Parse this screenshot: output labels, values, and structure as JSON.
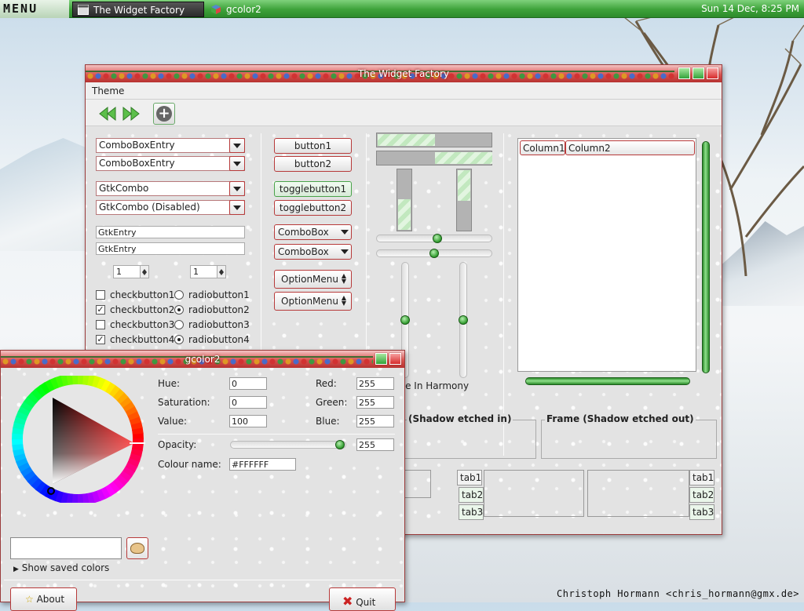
{
  "panel": {
    "menu_label": "MENU",
    "tasks": [
      {
        "label": "The Widget Factory"
      },
      {
        "label": "gcolor2"
      }
    ],
    "clock": "Sun 14 Dec,  8:25 PM"
  },
  "desktop": {
    "credit": "Christoph Hormann <chris_hormann@gmx.de>"
  },
  "widget_factory": {
    "title": "The Widget Factory",
    "menu": [
      "Theme"
    ],
    "combos": [
      {
        "label": "ComboBoxEntry"
      },
      {
        "label": "ComboBoxEntry"
      },
      {
        "label": "GtkCombo"
      },
      {
        "label": "GtkCombo (Disabled)"
      }
    ],
    "entries": [
      "GtkEntry",
      "GtkEntry"
    ],
    "spins": [
      "1",
      "1"
    ],
    "checks": [
      {
        "label": "checkbutton1",
        "checked": false
      },
      {
        "label": "checkbutton2",
        "checked": true
      },
      {
        "label": "checkbutton3",
        "checked": false
      },
      {
        "label": "checkbutton4",
        "checked": true
      }
    ],
    "radios": [
      {
        "label": "radiobutton1",
        "selected": false
      },
      {
        "label": "radiobutton2",
        "selected": true
      },
      {
        "label": "radiobutton3",
        "selected": false
      },
      {
        "label": "radiobutton4",
        "selected": true
      }
    ],
    "buttons": {
      "button1": "button1",
      "button2": "button2",
      "toggle1": "togglebutton1",
      "toggle2": "togglebutton2",
      "combobox1": "ComboBox",
      "combobox2": "ComboBox",
      "option1": "OptionMenu",
      "option2": "OptionMenu"
    },
    "progress": {
      "h1": 0.5,
      "h2": 0.5,
      "v1": 0.5,
      "v2": 0.5
    },
    "sliders": {
      "h1": 0.53,
      "h2": 0.5,
      "v1": 0.5,
      "v2": 0.5
    },
    "tree_columns": [
      "Column1",
      "Column2"
    ],
    "harmony_text": "ve In Harmony",
    "frames": [
      "(Shadow etched in)",
      "Frame (Shadow etched out)"
    ],
    "tabs": {
      "group2": [
        "tab1",
        "tab2",
        "tab3"
      ],
      "group3": [
        "tab1",
        "tab2",
        "tab3"
      ]
    }
  },
  "gcolor": {
    "title": "gcolor2",
    "hue_label": "Hue:",
    "hue": "0",
    "sat_label": "Saturation:",
    "sat": "0",
    "val_label": "Value:",
    "val": "100",
    "red_label": "Red:",
    "red": "255",
    "green_label": "Green:",
    "green": "255",
    "blue_label": "Blue:",
    "blue": "255",
    "opacity_label": "Opacity:",
    "opacity": "255",
    "name_label": "Colour name:",
    "name": "#FFFFFF",
    "show_saved": "Show saved colors",
    "about": "About",
    "quit": "Quit"
  }
}
